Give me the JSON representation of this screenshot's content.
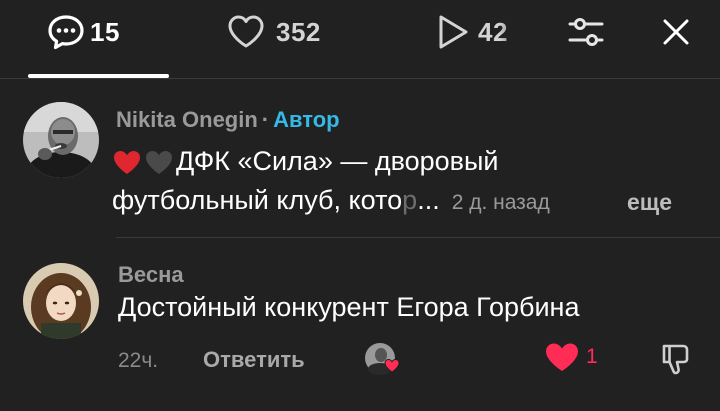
{
  "tabs": {
    "comments_count": "15",
    "likes_count": "352",
    "views_count": "42"
  },
  "comments": [
    {
      "author": "Nikita Onegin",
      "separator": "·",
      "badge": "Автор",
      "emojis": [
        "red-heart",
        "black-heart"
      ],
      "text_line1": "ДФК «Сила» — дворовый",
      "text_line2": "футбольный клуб, кото",
      "text_fade": "р",
      "ellipsis": "...",
      "time": "2 д. назад",
      "more": "еще"
    },
    {
      "author": "Весна",
      "text": "Достойный конкурент Егора Горбина",
      "time": "22ч.",
      "reply": "Ответить",
      "likes": "1"
    }
  ],
  "colors": {
    "background": "#212121",
    "author_badge": "#35b9e6",
    "like_red": "#ff2c55"
  }
}
